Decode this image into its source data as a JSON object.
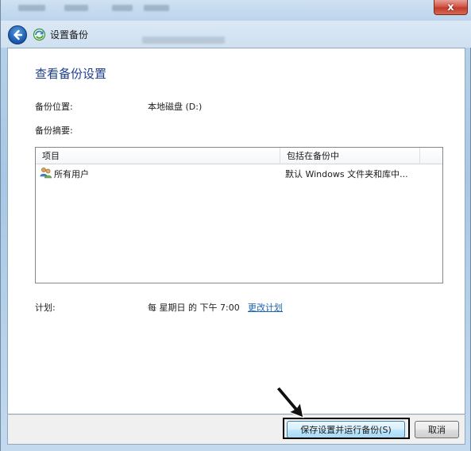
{
  "window": {
    "close_label": "x"
  },
  "nav": {
    "title": "设置备份"
  },
  "page": {
    "heading": "查看备份设置",
    "location_label": "备份位置:",
    "location_value": "本地磁盘 (D:)",
    "summary_label": "备份摘要:",
    "schedule_label": "计划:",
    "schedule_value": "每 星期日 的 下午 7:00",
    "change_schedule_link": "更改计划"
  },
  "summary_table": {
    "columns": [
      "项目",
      "包括在备份中"
    ],
    "rows": [
      {
        "item": "所有用户",
        "included": "默认 Windows 文件夹和库中..."
      }
    ]
  },
  "buttons": {
    "save_run": "保存设置并运行备份(S)",
    "cancel": "取消"
  },
  "colors": {
    "heading": "#1e3f8f",
    "link": "#1d62b5",
    "close_button": "#c23b2d"
  },
  "icons": {
    "back": "back-arrow-icon",
    "app": "backup-icon",
    "users": "users-icon",
    "annotation": "arrow-pointer"
  }
}
